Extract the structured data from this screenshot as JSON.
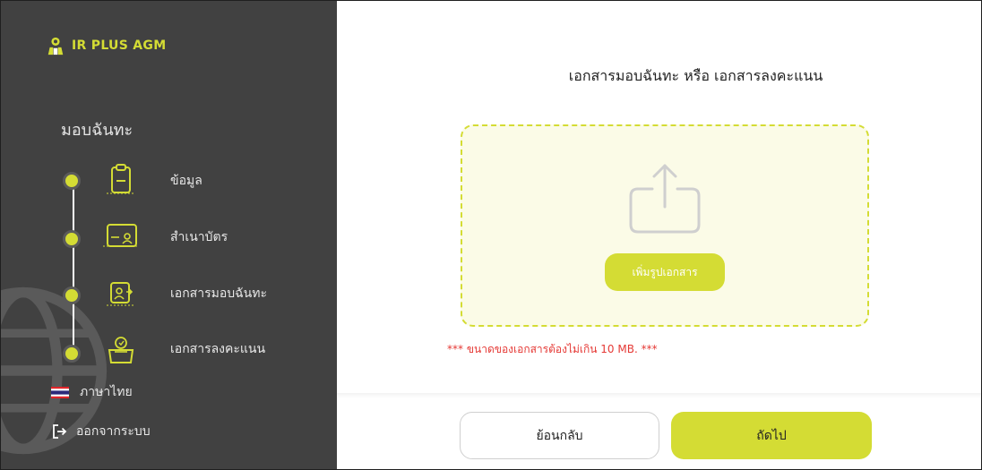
{
  "brand": {
    "name": "IR PLUS AGM",
    "accent_color": "#d4dc34"
  },
  "sidebar": {
    "section_title": "มอบฉันทะ",
    "steps": [
      {
        "label": "ข้อมูล",
        "icon": "clipboard-icon"
      },
      {
        "label": "สำเนาบัตร",
        "icon": "id-card-icon"
      },
      {
        "label": "เอกสารมอบฉันทะ",
        "icon": "proxy-document-icon"
      },
      {
        "label": "เอกสารลงคะแนน",
        "icon": "ballot-box-icon"
      }
    ],
    "language": {
      "label": "ภาษาไทย",
      "icon": "thai-flag-icon"
    },
    "logout": {
      "label": "ออกจากระบบ",
      "icon": "logout-icon"
    }
  },
  "main": {
    "title": "เอกสารมอบฉันทะ หรือ เอกสารลงคะแนน",
    "upload": {
      "icon": "upload-icon",
      "button_label": "เพิ่มรูปเอกสาร"
    },
    "note": "*** ขนาดของเอกสารต้องไม่เกิน 10 MB. ***",
    "note_color": "#e53935",
    "footer": {
      "back_label": "ย้อนกลับ",
      "next_label": "ถัดไป"
    }
  }
}
